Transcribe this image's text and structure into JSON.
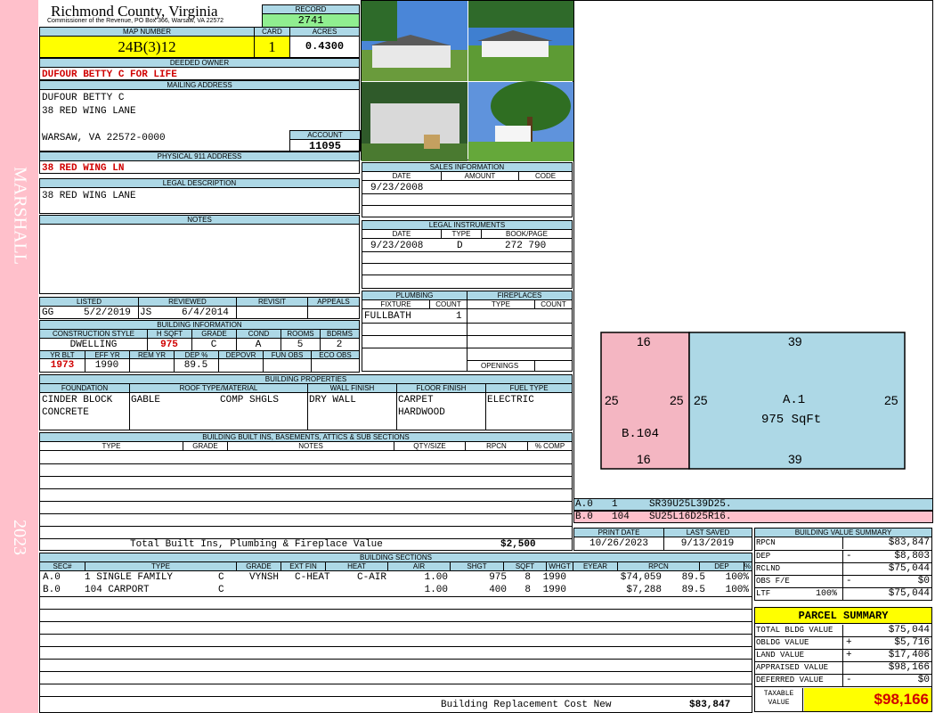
{
  "sidebar": {
    "owner_tag": "MARSHALL",
    "year": "2023"
  },
  "county": {
    "name": "Richmond County, Virginia",
    "address": "Commissioner of the Revenue, PO Box 366, Warsaw, VA 22572"
  },
  "record": {
    "label": "RECORD",
    "value": "2741"
  },
  "map": {
    "label": "MAP NUMBER",
    "value": "24B(3)12",
    "card_label": "CARD",
    "card": "1",
    "acres_label": "ACRES",
    "acres": "0.4300"
  },
  "owner": {
    "label": "DEEDED OWNER",
    "value": "DUFOUR BETTY C FOR LIFE"
  },
  "mailing": {
    "label": "MAILING ADDRESS",
    "line1": "DUFOUR BETTY C",
    "line2": "38 RED WING LANE",
    "line3": "WARSAW, VA 22572-0000"
  },
  "account": {
    "label": "ACCOUNT",
    "value": "11095"
  },
  "physical": {
    "label": "PHYSICAL 911 ADDRESS",
    "value": "38 RED WING LN"
  },
  "legal": {
    "label": "LEGAL DESCRIPTION",
    "value": "38 RED WING LANE"
  },
  "notes": {
    "label": "NOTES"
  },
  "sales": {
    "label": "SALES INFORMATION",
    "cols": [
      "DATE",
      "AMOUNT",
      "CODE"
    ],
    "rows": [
      [
        "9/23/2008",
        "",
        ""
      ]
    ]
  },
  "instruments": {
    "label": "LEGAL INSTRUMENTS",
    "cols": [
      "DATE",
      "TYPE",
      "BOOK/PAGE"
    ],
    "rows": [
      [
        "9/23/2008",
        "D",
        "272 790"
      ]
    ]
  },
  "plumbing": {
    "label": "PLUMBING",
    "cols": [
      "FIXTURE",
      "COUNT"
    ],
    "rows": [
      [
        "FULLBATH",
        "1"
      ]
    ]
  },
  "fireplaces": {
    "label": "FIREPLACES",
    "cols": [
      "TYPE",
      "COUNT"
    ],
    "openings": "OPENINGS"
  },
  "listing": {
    "cols": [
      "LISTED",
      "REVIEWED",
      "REVISIT",
      "APPEALS"
    ],
    "listed_by": "GG",
    "listed_date": "5/2/2019",
    "reviewed_by": "JS",
    "reviewed_date": "6/4/2014"
  },
  "building_info": {
    "label": "BUILDING INFORMATION",
    "cols": [
      "CONSTRUCTION STYLE",
      "H SQFT",
      "GRADE",
      "COND",
      "ROOMS",
      "BDRMS"
    ],
    "style": "DWELLING",
    "hsqft": "975",
    "grade": "C",
    "cond": "A",
    "rooms": "5",
    "bdrms": "2",
    "cols2": [
      "YR BLT",
      "EFF YR",
      "REM YR",
      "DEP %",
      "DEPOVR",
      "FUN OBS",
      "ECO OBS"
    ],
    "yr_blt": "1973",
    "eff_yr": "1990",
    "rem_yr": "",
    "dep": "89.5"
  },
  "properties": {
    "label": "BUILDING PROPERTIES",
    "cols": [
      "FOUNDATION",
      "ROOF TYPE/MATERIAL",
      "WALL FINISH",
      "FLOOR FINISH",
      "FUEL TYPE"
    ],
    "foundation1": "CINDER BLOCK",
    "foundation2": "CONCRETE",
    "roof_type": "GABLE",
    "roof_mat": "COMP SHGLS",
    "wall": "DRY WALL",
    "floor1": "CARPET",
    "floor2": "HARDWOOD",
    "fuel": "ELECTRIC"
  },
  "builtins": {
    "label": "BUILDING BUILT INS, BASEMENTS, ATTICS & SUB SECTIONS",
    "cols": [
      "TYPE",
      "GRADE",
      "NOTES",
      "QTY/SIZE",
      "RPCN",
      "% COMP"
    ],
    "total_label": "Total Built Ins, Plumbing & Fireplace Value",
    "total": "$2,500"
  },
  "print": {
    "print_label": "PRINT DATE",
    "print_date": "10/26/2023",
    "saved_label": "LAST SAVED",
    "saved_date": "9/13/2019"
  },
  "sections": {
    "label": "BUILDING SECTIONS",
    "cols": [
      "SEC#",
      "TYPE",
      "GRADE",
      "EXT FIN",
      "HEAT",
      "AIR",
      "SHGT",
      "SQFT",
      "WHGT",
      "EYEAR",
      "RPCN",
      "DEP",
      "% COMP"
    ],
    "rows": [
      {
        "sec": "A.0",
        "type": "1 SINGLE FAMILY",
        "grade": "C",
        "ext": "VYNSH",
        "heat": "C-HEAT",
        "air": "C-AIR",
        "shgt": "1.00",
        "sqft": "975",
        "whgt": "8",
        "eyear": "1990",
        "rpcn": "$74,059",
        "dep": "89.5",
        "comp": "100%"
      },
      {
        "sec": "B.0",
        "type": "104 CARPORT",
        "grade": "C",
        "ext": "",
        "heat": "",
        "air": "",
        "shgt": "1.00",
        "sqft": "400",
        "whgt": "8",
        "eyear": "1990",
        "rpcn": "$7,288",
        "dep": "89.5",
        "comp": "100%"
      }
    ],
    "total_label": "Building Replacement Cost New",
    "total": "$83,847"
  },
  "sketch": {
    "b_label": "B.104",
    "b_top": "16",
    "b_bottom": "16",
    "b_left": "25",
    "b_right": "25",
    "a_label": "A.1",
    "a_area": "975 SqFt",
    "a_top": "39",
    "a_bottom": "39",
    "a_left": "25",
    "a_right": "25",
    "color_b": "#f4b6c2",
    "color_a": "#add8e6",
    "legend": [
      {
        "code": "A.0",
        "num": "1",
        "vec": "SR39U25L39D25."
      },
      {
        "code": "B.0",
        "num": "104",
        "vec": "SU25L16D25R16."
      }
    ]
  },
  "value_summary": {
    "label": "BUILDING VALUE SUMMARY",
    "rows": [
      {
        "k": "RPCN",
        "s": "",
        "v": "$83,847"
      },
      {
        "k": "DEP",
        "s": "-",
        "v": "$8,803"
      },
      {
        "k": "RCLND",
        "s": "",
        "v": "$75,044"
      },
      {
        "k": "OBS F/E",
        "s": "-",
        "v": "$0"
      },
      {
        "k": "LTF",
        "p": "100%",
        "s": "",
        "v": "$75,044"
      }
    ]
  },
  "parcel": {
    "label": "PARCEL SUMMARY",
    "rows": [
      {
        "k": "TOTAL BLDG VALUE",
        "s": "",
        "v": "$75,044"
      },
      {
        "k": "OBLDG VALUE",
        "s": "+",
        "v": "$5,716"
      },
      {
        "k": "LAND VALUE",
        "s": "+",
        "v": "$17,406"
      },
      {
        "k": "APPRAISED VALUE",
        "s": "",
        "v": "$98,166"
      },
      {
        "k": "DEFERRED VALUE",
        "s": "-",
        "v": "$0"
      }
    ],
    "taxable_label1": "TAXABLE",
    "taxable_label2": "VALUE",
    "taxable": "$98,166"
  },
  "colors": {
    "header": "#add8e6",
    "yellow": "#ffff00",
    "green": "#90ee90",
    "pink": "#ffc0cb",
    "red": "#d00000"
  }
}
